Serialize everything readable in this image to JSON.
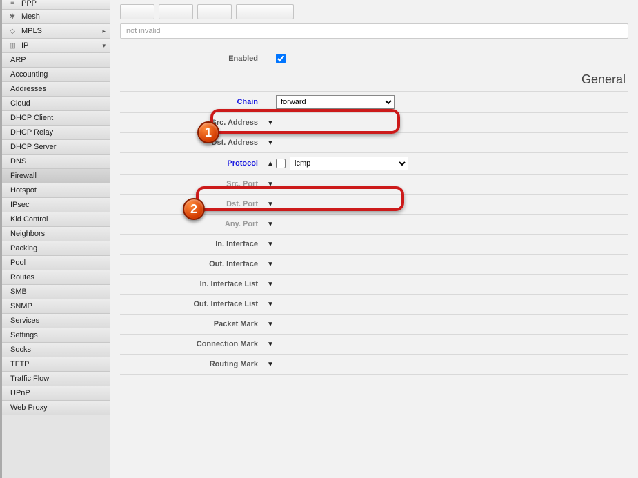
{
  "sidebar": {
    "top": [
      {
        "label": "PPP",
        "icon": "ppp-icon"
      },
      {
        "label": "Mesh",
        "icon": "mesh-icon"
      },
      {
        "label": "MPLS",
        "icon": "mpls-icon",
        "expandable": true,
        "arrow": "▸"
      },
      {
        "label": "IP",
        "icon": "ip-icon",
        "expandable": true,
        "arrow": "▾"
      }
    ],
    "ip_sub": [
      "ARP",
      "Accounting",
      "Addresses",
      "Cloud",
      "DHCP Client",
      "DHCP Relay",
      "DHCP Server",
      "DNS",
      "Firewall",
      "Hotspot",
      "IPsec",
      "Kid Control",
      "Neighbors",
      "Packing",
      "Pool",
      "Routes",
      "SMB",
      "SNMP",
      "Services",
      "Settings",
      "Socks",
      "TFTP",
      "Traffic Flow",
      "UPnP",
      "Web Proxy"
    ],
    "active": "Firewall"
  },
  "main": {
    "filter_text": "not invalid",
    "section": "General",
    "enabled_label": "Enabled",
    "enabled": true,
    "chain": {
      "label": "Chain",
      "value": "forward"
    },
    "protocol": {
      "label": "Protocol",
      "value": "icmp",
      "neg": false
    },
    "rows": {
      "src_addr": "Src. Address",
      "dst_addr": "Dst. Address",
      "src_port": "Src. Port",
      "dst_port": "Dst. Port",
      "any_port": "Any. Port",
      "in_iface": "In. Interface",
      "out_iface": "Out. Interface",
      "in_iface_list": "In. Interface List",
      "out_iface_list": "Out. Interface List",
      "packet_mark": "Packet Mark",
      "conn_mark": "Connection Mark",
      "routing_mark": "Routing Mark"
    }
  },
  "callouts": {
    "c1": {
      "num": "1"
    },
    "c2": {
      "num": "2"
    }
  }
}
